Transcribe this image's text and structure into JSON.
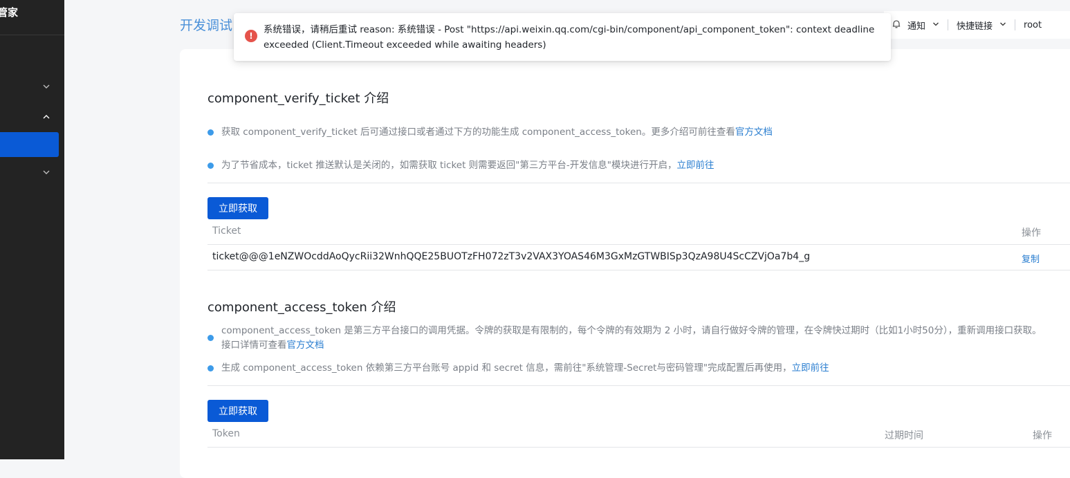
{
  "app": {
    "brand_fragment": "管家",
    "page_title": "开发调试"
  },
  "colors": {
    "primary": "#0a5ad6",
    "link": "#2a7ed0",
    "bullet": "#3d9be9",
    "error": "#e5534b",
    "sidebar_bg": "#232323"
  },
  "header": {
    "notify_label": "通知",
    "quicklinks_label": "快捷链接",
    "user_label": "root"
  },
  "toast": {
    "type": "error",
    "icon": "error-icon",
    "message": "系统错误，请稍后重试 reason: 系统错误 - Post \"https://api.weixin.qq.com/cgi-bin/component/api_component_token\": context deadline exceeded (Client.Timeout exceeded while awaiting headers)"
  },
  "ticket_section": {
    "title": "component_verify_ticket 介绍",
    "bullet1_text": "获取 component_verify_ticket 后可通过接口或者通过下方的功能生成 component_access_token。更多介绍可前往查看",
    "bullet1_link": "官方文档",
    "bullet2_text": "为了节省成本，ticket 推送默认是关闭的，如需获取 ticket 则需要返回\"第三方平台-开发信息\"模块进行开启，",
    "bullet2_link": "立即前往",
    "button_label": "立即获取",
    "table": {
      "col_ticket": "Ticket",
      "col_action": "操作",
      "rows": [
        {
          "ticket": "ticket@@@1eNZWOcddAoQycRii32WnhQQE25BUOTzFH072zT3v2VAX3YOAS46M3GxMzGTWBISp3QzA98U4ScCZVjOa7b4_g",
          "action": "复制"
        }
      ]
    }
  },
  "token_section": {
    "title": "component_access_token 介绍",
    "bullet1_line1": "component_access_token 是第三方平台接口的调用凭据。令牌的获取是有限制的，每个令牌的有效期为 2 小时，请自行做好令牌的管理，在令牌快过期时（比如1小时50分），重新调用接口获取。",
    "bullet1_line2": "接口详情可查看",
    "bullet1_link": "官方文档",
    "bullet2_text": "生成 component_access_token 依赖第三方平台账号 appid 和 secret 信息，需前往\"系统管理-Secret与密码管理\"完成配置后再使用，",
    "bullet2_link": "立即前往",
    "button_label": "立即获取",
    "table": {
      "col_token": "Token",
      "col_expire": "过期时间",
      "col_action": "操作"
    }
  }
}
